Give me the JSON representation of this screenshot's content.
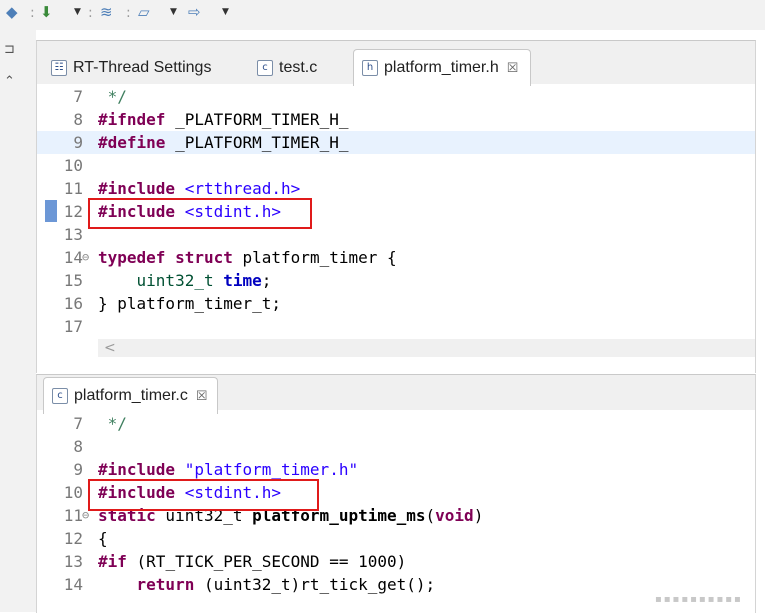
{
  "top_editor": {
    "tabs": [
      {
        "label": "RT-Thread Settings",
        "icon": "settings-file-icon"
      },
      {
        "label": "test.c",
        "icon": "c-file-icon"
      },
      {
        "label": "platform_timer.h",
        "icon": "h-file-icon",
        "active": true
      }
    ],
    "lines": [
      {
        "n": "7",
        "tokens": [
          {
            "t": " */",
            "c": "cmt"
          }
        ]
      },
      {
        "n": "8",
        "tokens": [
          {
            "t": "#ifndef",
            "c": "pp"
          },
          {
            "t": " _PLATFORM_TIMER_H_",
            "c": ""
          }
        ]
      },
      {
        "n": "9",
        "tokens": [
          {
            "t": "#define",
            "c": "pp"
          },
          {
            "t": " _PLATFORM_TIMER_H_",
            "c": ""
          }
        ]
      },
      {
        "n": "10",
        "tokens": []
      },
      {
        "n": "11",
        "tokens": [
          {
            "t": "#include",
            "c": "pp"
          },
          {
            "t": " <rtthread.h>",
            "c": "hdr"
          }
        ]
      },
      {
        "n": "12",
        "tokens": [
          {
            "t": "#include",
            "c": "pp"
          },
          {
            "t": " <stdint.h>",
            "c": "hdr"
          }
        ]
      },
      {
        "n": "13",
        "tokens": []
      },
      {
        "n": "14",
        "fold": "⊖",
        "tokens": [
          {
            "t": "typedef",
            "c": "kw"
          },
          {
            "t": " ",
            "c": ""
          },
          {
            "t": "struct",
            "c": "kw"
          },
          {
            "t": " platform_timer {",
            "c": ""
          }
        ]
      },
      {
        "n": "15",
        "tokens": [
          {
            "t": "    uint32_t ",
            "c": "typ"
          },
          {
            "t": "time",
            "c": "fld"
          },
          {
            "t": ";",
            "c": ""
          }
        ]
      },
      {
        "n": "16",
        "tokens": [
          {
            "t": "} platform_timer_t;",
            "c": ""
          }
        ]
      },
      {
        "n": "17",
        "tokens": []
      }
    ],
    "scroll_left": "<"
  },
  "bottom_editor": {
    "tabs": [
      {
        "label": "platform_timer.c",
        "icon": "c-file-icon",
        "active": true
      }
    ],
    "lines": [
      {
        "n": "7",
        "tokens": [
          {
            "t": " */",
            "c": "cmt"
          }
        ]
      },
      {
        "n": "8",
        "tokens": []
      },
      {
        "n": "9",
        "tokens": [
          {
            "t": "#include",
            "c": "pp"
          },
          {
            "t": " \"platform_timer.h\"",
            "c": "str"
          }
        ]
      },
      {
        "n": "10",
        "tokens": [
          {
            "t": "#include",
            "c": "pp"
          },
          {
            "t": " <stdint.h>",
            "c": "hdr"
          }
        ]
      },
      {
        "n": "11",
        "fold": "⊖",
        "tokens": [
          {
            "t": "static",
            "c": "kw"
          },
          {
            "t": " uint32_t ",
            "c": ""
          },
          {
            "t": "platform_uptime_ms",
            "c": "fn"
          },
          {
            "t": "(",
            "c": ""
          },
          {
            "t": "void",
            "c": "kw"
          },
          {
            "t": ")",
            "c": ""
          }
        ]
      },
      {
        "n": "12",
        "tokens": [
          {
            "t": "{",
            "c": ""
          }
        ]
      },
      {
        "n": "13",
        "tokens": [
          {
            "t": "#if",
            "c": "pp"
          },
          {
            "t": " (RT_TICK_PER_SECOND == 1000)",
            "c": ""
          }
        ]
      },
      {
        "n": "14",
        "tokens": [
          {
            "t": "    ",
            "c": ""
          },
          {
            "t": "return",
            "c": "kw"
          },
          {
            "t": " (uint32_t)rt_tick_get();",
            "c": ""
          }
        ]
      }
    ]
  },
  "toolbar": {
    "icons": [
      "build-icon",
      "download-icon",
      "debug-icon",
      "comment-icon",
      "arrow-icon"
    ],
    "close_glyph": "☒"
  }
}
